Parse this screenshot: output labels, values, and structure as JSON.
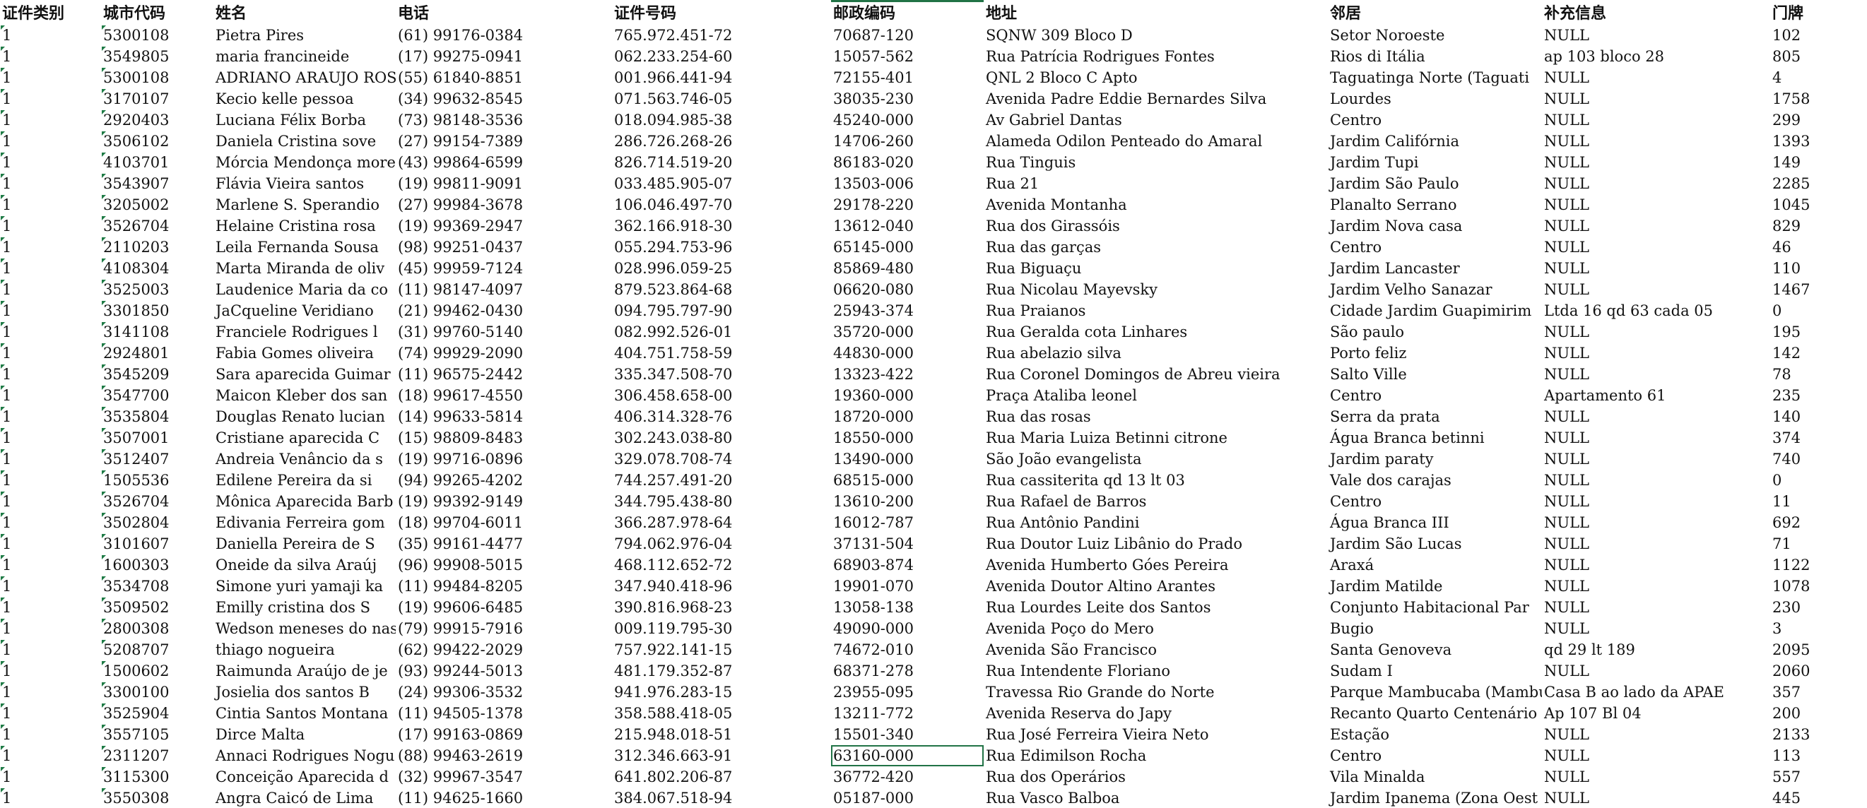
{
  "headers": [
    "证件类别",
    "城市代码",
    "姓名",
    "电话",
    "证件号码",
    "邮政编码",
    "地址",
    "邻居",
    "补充信息",
    "门牌"
  ],
  "rows": [
    [
      "1",
      "5300108",
      "Pietra Pires",
      "(61) 99176-0384",
      "765.972.451-72",
      "70687-120",
      "SQNW 309 Bloco D",
      "Setor Noroeste",
      "NULL",
      "102"
    ],
    [
      "1",
      "3549805",
      "maria francineide",
      "(17) 99275-0941",
      "062.233.254-60",
      "15057-562",
      "Rua Patrícia Rodrigues Fontes",
      "Rios di Itália",
      "ap 103 bloco 28",
      "805"
    ],
    [
      "1",
      "5300108",
      "ADRIANO ARAUJO ROSA",
      "(55) 61840-8851",
      "001.966.441-94",
      "72155-401",
      "QNL 2 Bloco C Apto",
      "Taguatinga Norte (Taguati",
      "NULL",
      "4"
    ],
    [
      "1",
      "3170107",
      "Kecio kelle pessoa",
      "(34) 99632-8545",
      "071.563.746-05",
      "38035-230",
      "Avenida Padre Eddie Bernardes Silva",
      "Lourdes",
      "NULL",
      "1758"
    ],
    [
      "1",
      "2920403",
      "Luciana Félix Borba",
      "(73) 98148-3536",
      "018.094.985-38",
      "45240-000",
      "Av Gabriel Dantas",
      "Centro",
      "NULL",
      "299"
    ],
    [
      "1",
      "3506102",
      "Daniela Cristina sove",
      "(27) 99154-7389",
      "286.726.268-26",
      "14706-260",
      "Alameda Odilon Penteado do Amaral",
      "Jardim Califórnia",
      "NULL",
      "1393"
    ],
    [
      "1",
      "4103701",
      "Mórcia Mendonça morei",
      "(43) 99864-6599",
      "826.714.519-20",
      "86183-020",
      "Rua Tinguis",
      "Jardim Tupi",
      "NULL",
      "149"
    ],
    [
      "1",
      "3543907",
      "Flávia Vieira santos",
      "(19) 99811-9091",
      "033.485.905-07",
      "13503-006",
      "Rua 21",
      "Jardim São Paulo",
      "NULL",
      "2285"
    ],
    [
      "1",
      "3205002",
      "Marlene S. Sperandio",
      "(27) 99984-3678",
      "106.046.497-70",
      "29178-220",
      "Avenida Montanha",
      "Planalto Serrano",
      "NULL",
      "1045"
    ],
    [
      "1",
      "3526704",
      "Helaine Cristina rosa",
      "(19) 99369-2947",
      "362.166.918-30",
      "13612-040",
      "Rua dos Girassóis",
      "Jardim Nova casa",
      "NULL",
      "829"
    ],
    [
      "1",
      "2110203",
      "Leila Fernanda Sousa",
      "(98) 99251-0437",
      "055.294.753-96",
      "65145-000",
      "Rua das garças",
      "Centro",
      "NULL",
      "46"
    ],
    [
      "1",
      "4108304",
      "Marta Miranda de oliv",
      "(45) 99959-7124",
      "028.996.059-25",
      "85869-480",
      "Rua Biguaçu",
      "Jardim Lancaster",
      "NULL",
      "110"
    ],
    [
      "1",
      "3525003",
      "Laudenice Maria da co",
      "(11) 98147-4097",
      "879.523.864-68",
      "06620-080",
      "Rua Nicolau Mayevsky",
      "Jardim Velho Sanazar",
      "NULL",
      "1467"
    ],
    [
      "1",
      "3301850",
      "JaCqueline Veridiano",
      "(21) 99462-0430",
      "094.795.797-90",
      "25943-374",
      "Rua Praianos",
      "Cidade Jardim Guapimirim",
      "Ltda 16 qd 63 cada 05",
      "0"
    ],
    [
      "1",
      "3141108",
      "Franciele Rodrigues l",
      "(31) 99760-5140",
      "082.992.526-01",
      "35720-000",
      "Rua Geralda cota Linhares",
      "São paulo",
      "NULL",
      "195"
    ],
    [
      "1",
      "2924801",
      "Fabia Gomes oliveira",
      "(74) 99929-2090",
      "404.751.758-59",
      "44830-000",
      "Rua abelazio silva",
      "Porto feliz",
      "NULL",
      "142"
    ],
    [
      "1",
      "3545209",
      "Sara aparecida Guimar",
      "(11) 96575-2442",
      "335.347.508-70",
      "13323-422",
      "Rua Coronel Domingos de Abreu vieira",
      "Salto Ville",
      "NULL",
      "78"
    ],
    [
      "1",
      "3547700",
      "Maicon Kleber dos san",
      "(18) 99617-4550",
      "306.458.658-00",
      "19360-000",
      "Praça Ataliba leonel",
      "Centro",
      "Apartamento 61",
      "235"
    ],
    [
      "1",
      "3535804",
      "Douglas Renato lucian",
      "(14) 99633-5814",
      "406.314.328-76",
      "18720-000",
      "Rua das rosas",
      "Serra da prata",
      "NULL",
      "140"
    ],
    [
      "1",
      "3507001",
      "Cristiane aparecida C",
      "(15) 98809-8483",
      "302.243.038-80",
      "18550-000",
      "Rua Maria Luiza Betinni citrone",
      "Água Branca betinni",
      "NULL",
      "374"
    ],
    [
      "1",
      "3512407",
      "Andreia Venâncio da s",
      "(19) 99716-0896",
      "329.078.708-74",
      "13490-000",
      "São João evangelista",
      "Jardim paraty",
      "NULL",
      "740"
    ],
    [
      "1",
      "1505536",
      "Edilene Pereira da si",
      "(94) 99265-4202",
      "744.257.491-20",
      "68515-000",
      "Rua cassiterita qd 13 lt 03",
      "Vale dos carajas",
      "NULL",
      "0"
    ],
    [
      "1",
      "3526704",
      "Mônica Aparecida Barb",
      "(19) 99392-9149",
      "344.795.438-80",
      "13610-200",
      "Rua Rafael de Barros",
      "Centro",
      "NULL",
      "11"
    ],
    [
      "1",
      "3502804",
      "Edivania Ferreira gom",
      "(18) 99704-6011",
      "366.287.978-64",
      "16012-787",
      "Rua Antônio Pandini",
      "Água Branca III",
      "NULL",
      "692"
    ],
    [
      "1",
      "3101607",
      "Daniella Pereira de S",
      "(35) 99161-4477",
      "794.062.976-04",
      "37131-504",
      "Rua Doutor Luiz Libânio do Prado",
      "Jardim São Lucas",
      "NULL",
      "71"
    ],
    [
      "1",
      "1600303",
      "Oneide da silva Araúj",
      "(96) 99908-5015",
      "468.112.652-72",
      "68903-874",
      "Avenida Humberto Góes Pereira",
      "Araxá",
      "NULL",
      "1122"
    ],
    [
      "1",
      "3534708",
      "Simone yuri yamaji ka",
      "(11) 99484-8205",
      "347.940.418-96",
      "19901-070",
      "Avenida Doutor Altino Arantes",
      "Jardim Matilde",
      "NULL",
      "1078"
    ],
    [
      "1",
      "3509502",
      "Emilly cristina dos S",
      "(19) 99606-6485",
      "390.816.968-23",
      "13058-138",
      "Rua Lourdes Leite dos Santos",
      "Conjunto Habitacional Par",
      "NULL",
      "230"
    ],
    [
      "1",
      "2800308",
      "Wedson meneses do nas",
      "(79) 99915-7916",
      "009.119.795-30",
      "49090-000",
      "Avenida Poço do Mero",
      "Bugio",
      "NULL",
      "3"
    ],
    [
      "1",
      "5208707",
      "thiago nogueira",
      "(62) 99422-2029",
      "757.922.141-15",
      "74672-010",
      "Avenida São Francisco",
      "Santa Genoveva",
      "qd 29 lt 189",
      "2095"
    ],
    [
      "1",
      "1500602",
      "Raimunda Araújo de je",
      "(93) 99244-5013",
      "481.179.352-87",
      "68371-278",
      "Rua Intendente Floriano",
      "Sudam I",
      "NULL",
      "2060"
    ],
    [
      "1",
      "3300100",
      "Josielia dos santos B",
      "(24) 99306-3532",
      "941.976.283-15",
      "23955-095",
      "Travessa Rio Grande do Norte",
      "Parque Mambucaba (Mambuca",
      "Casa B ao lado da APAE",
      "357"
    ],
    [
      "1",
      "3525904",
      "Cintia Santos Montana",
      "(11) 94505-1378",
      "358.588.418-05",
      "13211-772",
      "Avenida Reserva do Japy",
      "Recanto Quarto Centenário",
      "Ap 107 Bl 04",
      "200"
    ],
    [
      "1",
      "3557105",
      "Dirce Malta",
      "(17) 99163-0869",
      "215.948.018-51",
      "15501-340",
      "Rua José Ferreira Vieira Neto",
      "Estação",
      "NULL",
      "2133"
    ],
    [
      "1",
      "2311207",
      "Annaci Rodrigues Nogu",
      "(88) 99463-2619",
      "312.346.663-91",
      "63160-000",
      "Rua Edimilson Rocha",
      "Centro",
      "NULL",
      "113"
    ],
    [
      "1",
      "3115300",
      "Conceição Aparecida d",
      "(32) 99967-3547",
      "641.802.206-87",
      "36772-420",
      "Rua dos Operários",
      "Vila Minalda",
      "NULL",
      "557"
    ],
    [
      "1",
      "3550308",
      "Angra Caicó de Lima",
      "(11) 94625-1660",
      "384.067.518-94",
      "05187-000",
      "Rua Vasco Balboa",
      "Jardim Ipanema (Zona Oest",
      "NULL",
      "445"
    ]
  ],
  "selected_cell": {
    "row": 34,
    "col": 5
  },
  "colors": {
    "selection": "#217346",
    "text_marker": "#1e7b45"
  }
}
